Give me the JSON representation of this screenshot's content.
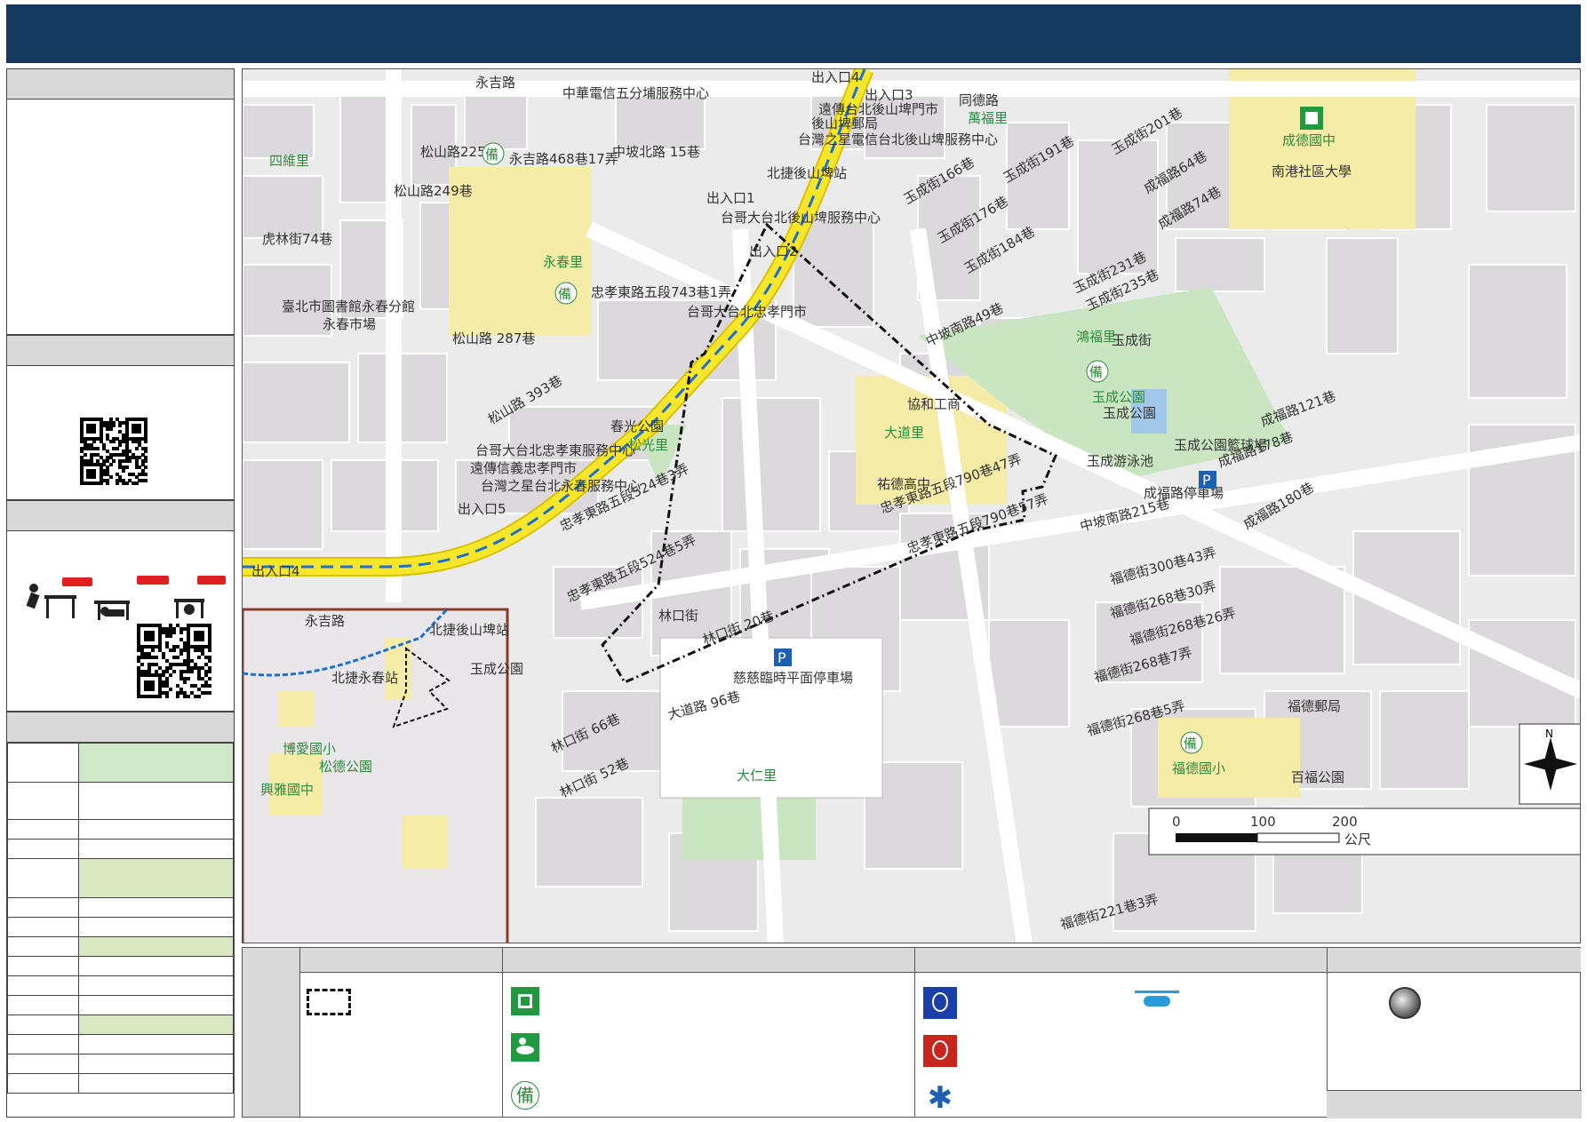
{
  "map": {
    "scale_bar": {
      "ticks": [
        "0",
        "100",
        "200"
      ],
      "unit": "公尺"
    },
    "compass": {
      "north_label": "N"
    },
    "labels": {
      "yongji_rd": "永吉路",
      "zhonghua_telecom": "中華電信五分埔服務中心",
      "exit4_top": "出入口4",
      "exit3": "出入口3",
      "exit1": "出入口1",
      "exit2": "出入口2",
      "exit5": "出入口5",
      "exit4_left": "出入口4",
      "fareastone_houshanpi": "遠傳台北後山埤門市",
      "houshanpi_post": "後山埤郵局",
      "tstar_houshanpi": "台灣之星電信台北後山埤服務中心",
      "mrt_houshanpi": "北捷後山埤站",
      "twm_houshanpi": "台哥大台北後山埤服務中心",
      "songshan_rd_225": "松山路225巷",
      "songshan_rd_249": "松山路249巷",
      "songshan_rd_287": "松山路 287巷",
      "songshan_rd_393": "松山路 393巷",
      "yongji_468_17": "永吉路468巷17弄",
      "zhongpo_n_15": "中坡北路 15巷",
      "yongchun_li": "永春里",
      "zhongxiao_743_1": "忠孝東路五段743巷1弄",
      "library": "臺北市圖書館永春分館",
      "yongchun_market": "永春市場",
      "sichuan_li": "四維里",
      "huling_74": "虎林街74巷",
      "twm_zhongxiao": "台哥大台北忠孝門市",
      "twm_zhongxiao_e": "台哥大台北忠孝東服務中心",
      "fareastone_xinyi": "遠傳信義忠孝門市",
      "tstar_yongchun": "台灣之星台北永春服務中心",
      "chunguang_park": "春光公園",
      "songguang_li": "松光里",
      "zhongxiao_524_3": "忠孝東路五段524巷3弄",
      "zhongxiao_524_5": "忠孝東路五段524巷5弄",
      "zhongxiao_790_47": "忠孝東路五段790巷47弄",
      "zhongxiao_790_57": "忠孝東路五段790巷57弄",
      "dadao_li": "大道里",
      "shanhe_vocational": "協和工商",
      "youde_high": "祐德高中",
      "yucheng_park": "玉成公園",
      "yucheng_park2": "玉成公園",
      "yucheng_park_court": "玉成公園籃球場",
      "yucheng_pool": "玉成游泳池",
      "hongfu_li": "鴻福里",
      "chengfu_parking": "成福路停車場",
      "chengde_junior": "成德國中",
      "nangang_university": "南港社區大學",
      "wanfu_li": "萬福里",
      "tongde_rd": "同德路",
      "fude_268_7": "福德街268巷7弄",
      "fude_268_5": "福德街268巷5弄",
      "fude_268_26": "福德街268巷26弄",
      "fude_268_30": "福德街268巷30弄",
      "fude_300_43": "福德街300巷43弄",
      "fude_221_3": "福德街221巷3弄",
      "fude_post": "福德郵局",
      "fude_elementary": "福德國小",
      "baifu_park": "百福公園",
      "zhongpo_s_215": "中坡南路215巷",
      "zhongpo_s_49": "中坡南路49巷",
      "linkou_st": "林口街",
      "linkou_66": "林口街 66巷",
      "linkou_52": "林口街 52巷",
      "linkou_20": "林口街 20巷",
      "dadao_rd_96": "大道路 96巷",
      "ciji_parking": "慈慈臨時平面停車場",
      "daren_li": "大仁里",
      "yucheng_231": "玉成街231巷",
      "yucheng_235": "玉成街235巷",
      "yucheng_184": "玉成街184巷",
      "yucheng_176": "玉成街176巷",
      "yucheng_166": "玉成街166巷",
      "yucheng_191": "玉成街191巷",
      "yucheng_201": "玉成街201巷",
      "chengfu_64": "成福路64巷",
      "chengfu_74": "成福路74巷",
      "chengfu_121": "成福路121巷",
      "chengfu_178": "成福路178巷",
      "chengfu_180": "成福路180巷",
      "yucheng_st": "玉成街",
      "bei_mark": "備"
    },
    "inset_labels": {
      "yongji": "永吉路",
      "bo_ai": "博愛國小",
      "songde_park": "松德公園",
      "xingya": "興雅國中",
      "beijie_yongchun": "北捷永春站",
      "houshanpi": "北捷後山埤站",
      "yucheng": "玉成公園"
    }
  },
  "legend": {
    "bei_mark": "備"
  },
  "colors": {
    "title_bar": "#163a5f",
    "school": "#f5eca8",
    "park": "#c9e6c0",
    "metro_line": "#f7e62a",
    "metro_route": "#1d6fd4",
    "table_highlight": "#cfe9c8",
    "table_highlight2": "#d9e8c0"
  }
}
